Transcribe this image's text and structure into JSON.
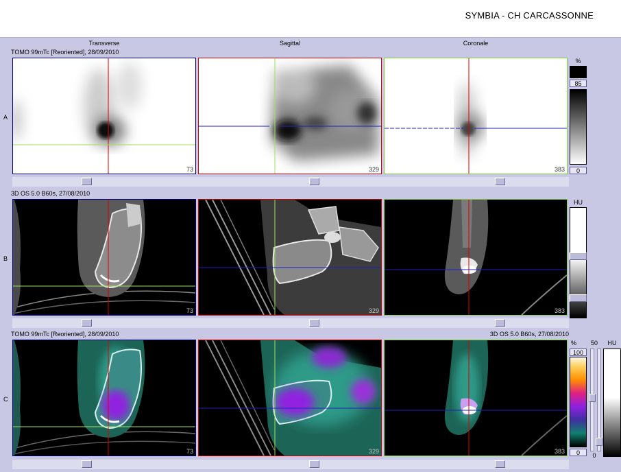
{
  "header": {
    "title": "SYMBIA - CH CARCASSONNE"
  },
  "columns": {
    "transverse": "Transverse",
    "sagittal": "Sagittal",
    "coronal": "Coronale"
  },
  "rows": {
    "a": {
      "letter": "A",
      "info": "TOMO 99mTc [Reoriented], 28/09/2010"
    },
    "b": {
      "letter": "B",
      "info": "3D  OS  5.0  B60s, 27/08/2010"
    },
    "c": {
      "letter": "C",
      "info": "TOMO 99mTc [Reoriented], 28/09/2010",
      "info_right": "3D  OS  5.0  B60s, 27/08/2010"
    }
  },
  "slices": {
    "transverse": "73",
    "sagittal": "329",
    "coronal": "383"
  },
  "colorbars": {
    "a": {
      "unit": "%",
      "top": "85",
      "bottom": "0"
    },
    "b": {
      "unit": "HU"
    },
    "c": {
      "unit": "%",
      "top": "100",
      "bottom": "0",
      "slider_top": "50",
      "slider_bottom": "0",
      "unit2": "HU"
    }
  },
  "colors": {
    "crosshair_red": "#e00000",
    "crosshair_green": "#a0e060",
    "crosshair_blue": "#2020c0",
    "border_transverse": "#000080",
    "border_sagittal": "#d00000",
    "border_coronal": "#80d040"
  }
}
